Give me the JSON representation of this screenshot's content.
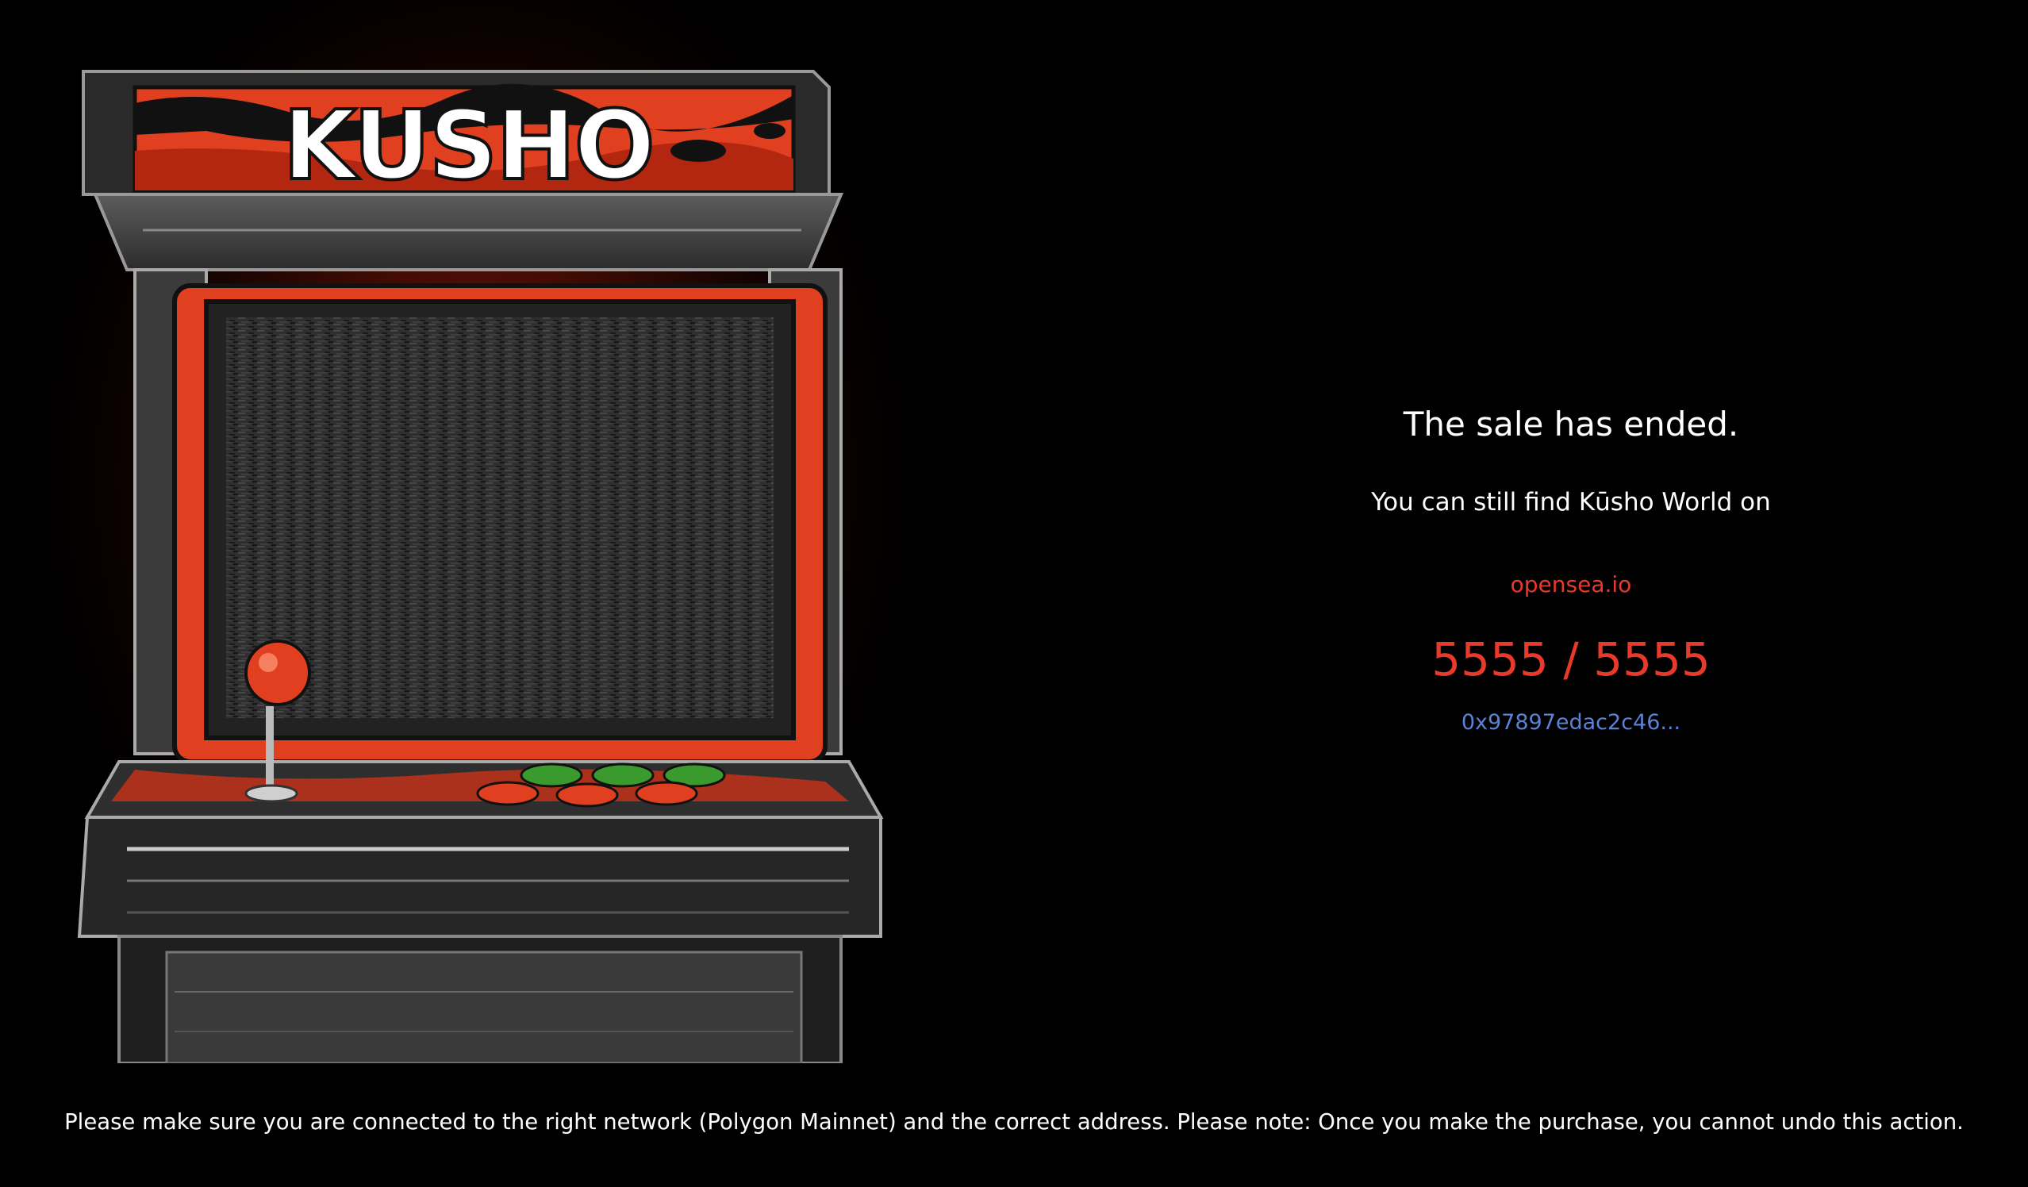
{
  "logo": {
    "text": "KUSHO"
  },
  "sale": {
    "title": "The sale has ended.",
    "subtitle": "You can still find Kūsho World on",
    "marketplace_link": "opensea.io",
    "minted_count": "5555 / 5555",
    "contract_address": "0x97897edac2c46..."
  },
  "footer": {
    "notice": "Please make sure you are connected to the right network (Polygon Mainnet) and the correct address. Please note: Once you make the purchase, you cannot undo this action."
  },
  "colors": {
    "background": "#000000",
    "accent_red": "#e8392b",
    "link_blue": "#5b82d6",
    "cabinet_red": "#e0401f",
    "button_green": "#3a9a2e"
  }
}
